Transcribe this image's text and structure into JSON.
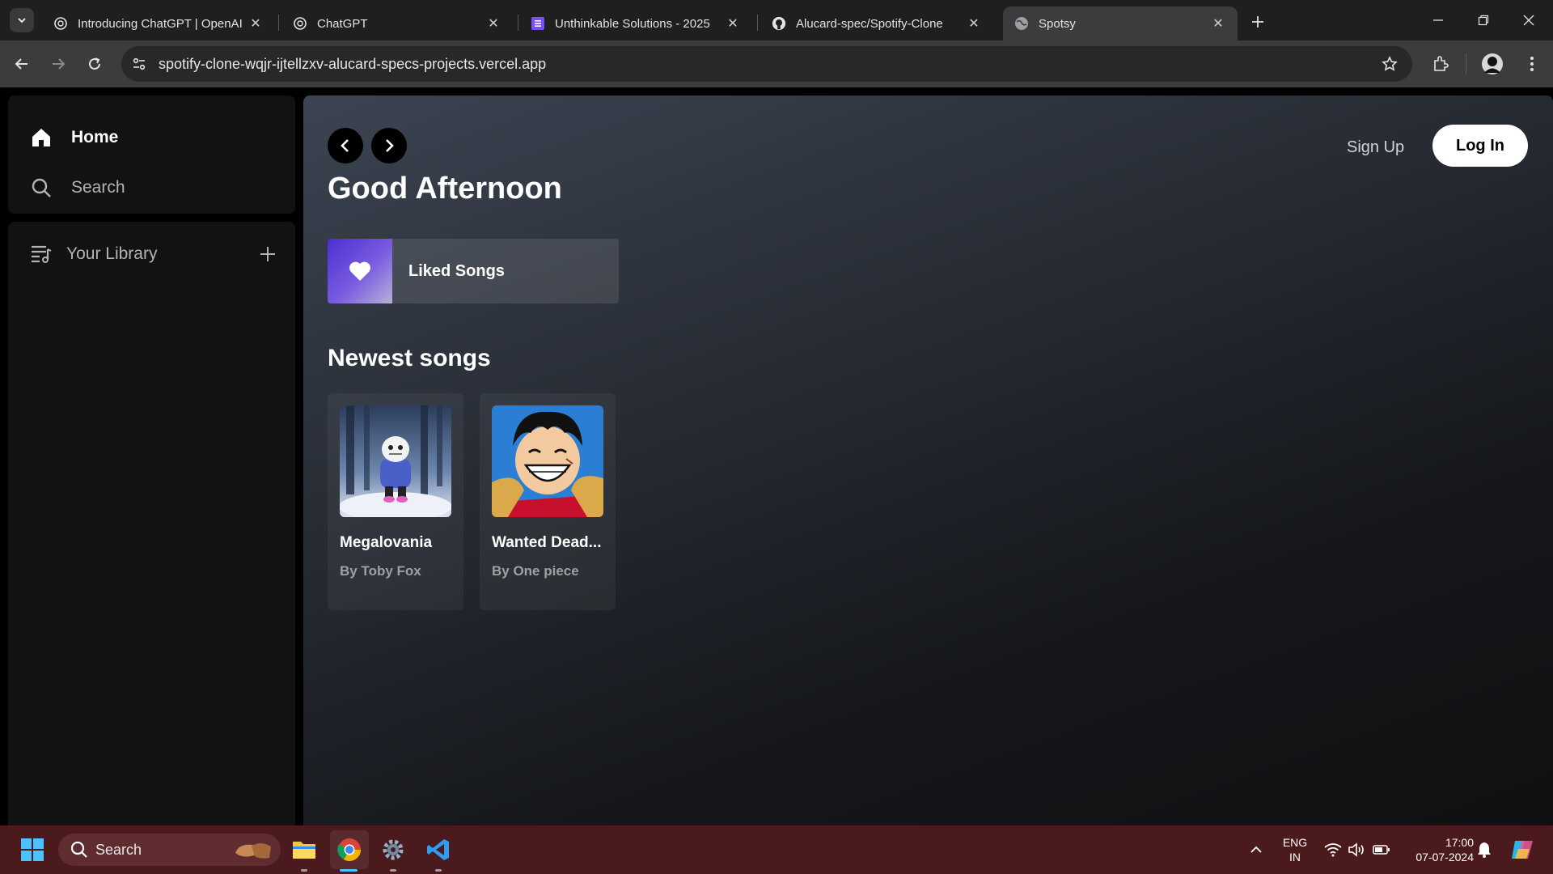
{
  "browser": {
    "tabs": [
      {
        "title": "Introducing ChatGPT | OpenAI",
        "icon": "openai-icon",
        "active": false
      },
      {
        "title": "ChatGPT",
        "icon": "openai-icon",
        "active": false
      },
      {
        "title": "Unthinkable Solutions - 2025",
        "icon": "forms-icon",
        "active": false
      },
      {
        "title": "Alucard-spec/Spotify-Clone",
        "icon": "github-icon",
        "active": false
      },
      {
        "title": "Spotsy",
        "icon": "globe-icon",
        "active": true
      }
    ],
    "url": "spotify-clone-wqjr-ijtellzxv-alucard-specs-projects.vercel.app"
  },
  "sidebar": {
    "home_label": "Home",
    "search_label": "Search",
    "library_label": "Your Library"
  },
  "header": {
    "signup_label": "Sign Up",
    "login_label": "Log In"
  },
  "main": {
    "greeting": "Good Afternoon",
    "liked_songs_label": "Liked Songs",
    "newest_title": "Newest songs",
    "songs": [
      {
        "title": "Megalovania",
        "artist": "By Toby Fox"
      },
      {
        "title": "Wanted Dead...",
        "artist": "By One piece"
      }
    ]
  },
  "taskbar": {
    "search_label": "Search",
    "lang_top": "ENG",
    "lang_bottom": "IN",
    "time": "17:00",
    "date": "07-07-2024"
  },
  "colors": {
    "accent_liked": "#4a2fd0",
    "taskbar_bg": "#4a1a1d",
    "panel_bg": "#121212"
  }
}
